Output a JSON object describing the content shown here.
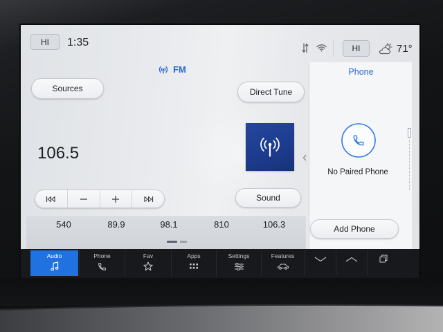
{
  "status_bar": {
    "driver_climate": "HI",
    "time": "1:35",
    "passenger_climate": "HI",
    "outside_temp": "71°",
    "icons": [
      "data-transfer-icon",
      "wifi-icon",
      "weather-icon"
    ]
  },
  "audio": {
    "band": "FM",
    "band_icon": "radio-signal-icon",
    "sources_label": "Sources",
    "direct_tune_label": "Direct Tune",
    "frequency": "106.5",
    "artwork_icon": "antenna-icon",
    "controls": [
      "seek-back-icon",
      "tune-down-icon",
      "tune-up-icon",
      "seek-forward-icon"
    ],
    "sound_label": "Sound",
    "presets": [
      "540",
      "89.9",
      "98.1",
      "810",
      "106.3"
    ]
  },
  "phone_panel": {
    "title": "Phone",
    "icon": "phone-icon",
    "status": "No Paired Phone",
    "add_phone_label": "Add Phone"
  },
  "nav": {
    "items": [
      {
        "label": "Audio",
        "icon": "music-note-icon",
        "active": true
      },
      {
        "label": "Phone",
        "icon": "phone-icon",
        "active": false
      },
      {
        "label": "Fav",
        "icon": "star-icon",
        "active": false
      },
      {
        "label": "Apps",
        "icon": "apps-grid-icon",
        "active": false
      },
      {
        "label": "Settings",
        "icon": "settings-sliders-icon",
        "active": false
      },
      {
        "label": "Features",
        "icon": "car-icon",
        "active": false
      }
    ],
    "extra_icons": [
      "chevron-down-icon",
      "chevron-up-icon",
      "windows-icon"
    ]
  },
  "colors": {
    "accent": "#1f72df",
    "link_blue": "#2468d6",
    "screen_bg": "#e6e8eb",
    "nav_bg": "#17191d",
    "artwork_bg": "#1d3b8d"
  }
}
